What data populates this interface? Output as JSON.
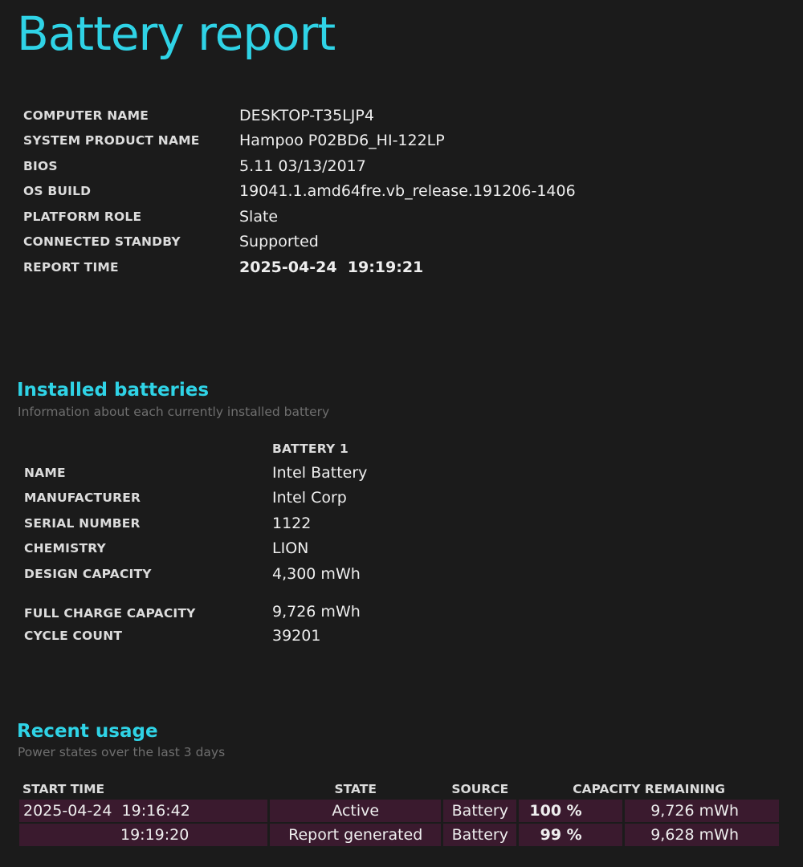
{
  "title": "Battery report",
  "system_info": [
    {
      "label": "COMPUTER NAME",
      "value": "DESKTOP-T35LJP4"
    },
    {
      "label": "SYSTEM PRODUCT NAME",
      "value": "Hampoo P02BD6_HI-122LP"
    },
    {
      "label": "BIOS",
      "value": "5.11 03/13/2017"
    },
    {
      "label": "OS BUILD",
      "value": "19041.1.amd64fre.vb_release.191206-1406"
    },
    {
      "label": "PLATFORM ROLE",
      "value": "Slate"
    },
    {
      "label": "CONNECTED STANDBY",
      "value": "Supported"
    },
    {
      "label": "REPORT TIME",
      "value": "2025-04-24  19:19:21"
    }
  ],
  "installed_batteries": {
    "title": "Installed batteries",
    "subtitle": "Information about each currently installed battery",
    "column_header": "BATTERY 1",
    "rows": [
      {
        "label": "NAME",
        "value": "Intel Battery"
      },
      {
        "label": "MANUFACTURER",
        "value": "Intel Corp"
      },
      {
        "label": "SERIAL NUMBER",
        "value": "1122"
      },
      {
        "label": "CHEMISTRY",
        "value": "LION"
      },
      {
        "label": "DESIGN CAPACITY",
        "value": "4,300 mWh"
      },
      {
        "label": "FULL CHARGE CAPACITY",
        "value": "9,726 mWh"
      },
      {
        "label": "CYCLE COUNT",
        "value": "39201"
      }
    ]
  },
  "recent_usage": {
    "title": "Recent usage",
    "subtitle": "Power states over the last 3 days",
    "headers": {
      "start_time": "START TIME",
      "state": "STATE",
      "source": "SOURCE",
      "capacity_remaining": "CAPACITY REMAINING"
    },
    "rows": [
      {
        "date": "2025-04-24",
        "time": "19:16:42",
        "state": "Active",
        "source": "Battery",
        "percent": "100 %",
        "mwh": "9,726 mWh"
      },
      {
        "date": "",
        "time": "19:19:20",
        "state": "Report generated",
        "source": "Battery",
        "percent": "99 %",
        "mwh": "9,628 mWh"
      }
    ]
  },
  "colors": {
    "background": "#1b1b1b",
    "accent": "#2fd3e6",
    "row_fill": "#3a1a2e"
  }
}
